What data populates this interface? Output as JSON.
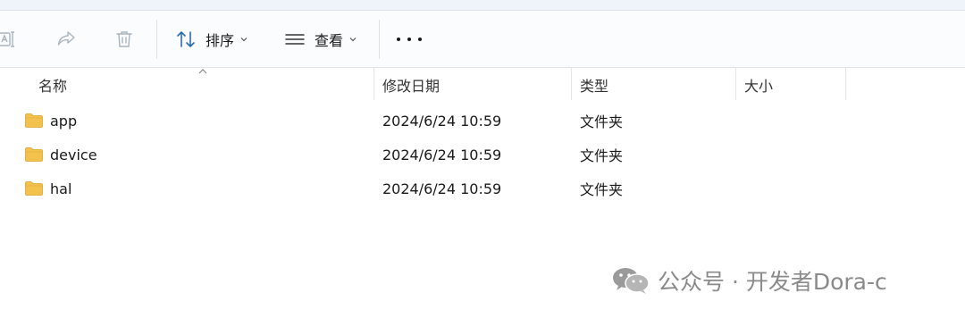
{
  "toolbar": {
    "sort_label": "排序",
    "view_label": "查看",
    "icons": [
      "rename-icon",
      "share-icon",
      "delete-icon",
      "sort-icon",
      "view-icon",
      "more-icon"
    ]
  },
  "columns": {
    "name": "名称",
    "modified": "修改日期",
    "type": "类型",
    "size": "大小"
  },
  "files": [
    {
      "name": "app",
      "modified": "2024/6/24 10:59",
      "type": "文件夹",
      "size": ""
    },
    {
      "name": "device",
      "modified": "2024/6/24 10:59",
      "type": "文件夹",
      "size": ""
    },
    {
      "name": "hal",
      "modified": "2024/6/24 10:59",
      "type": "文件夹",
      "size": ""
    }
  ],
  "watermark": {
    "text": "公众号 · 开发者Dora-c"
  },
  "colors": {
    "folder": "#f2c14e",
    "accent": "#2b6cb0",
    "icon_disabled": "#a9b4bf"
  }
}
